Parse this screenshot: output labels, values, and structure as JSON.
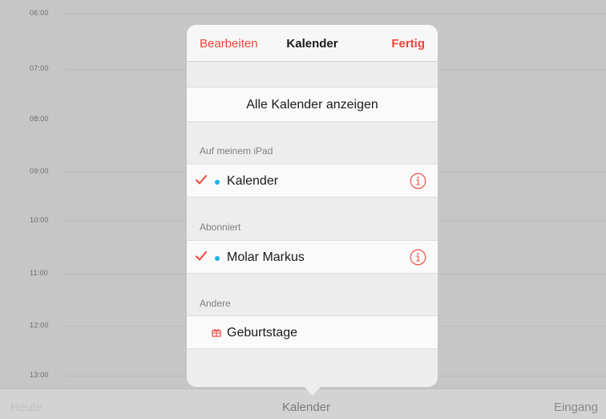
{
  "day_view": {
    "hours": [
      "06:00",
      "07:00",
      "08:00",
      "09:00",
      "10:00",
      "11:00",
      "12:00",
      "13:00"
    ]
  },
  "toolbar": {
    "today_label": "Heute",
    "calendars_label": "Kalender",
    "inbox_label": "Eingang"
  },
  "popover": {
    "nav": {
      "edit_label": "Bearbeiten",
      "title": "Kalender",
      "done_label": "Fertig"
    },
    "show_all_label": "Alle Kalender anzeigen",
    "sections": [
      {
        "header": "Auf meinem iPad",
        "items": [
          {
            "label": "Kalender",
            "checked": true,
            "dot_color": "#1eb0ea",
            "icon": "info-icon"
          }
        ]
      },
      {
        "header": "Abonniert",
        "items": [
          {
            "label": "Molar Markus",
            "checked": true,
            "dot_color": "#1eb0ea",
            "icon": "info-icon"
          }
        ]
      },
      {
        "header": "Andere",
        "items": [
          {
            "label": "Geburtstage",
            "checked": false,
            "icon": "gift-icon"
          }
        ]
      }
    ]
  },
  "colors": {
    "accent": "#f2453a",
    "calendar_dot": "#1eb0ea"
  }
}
